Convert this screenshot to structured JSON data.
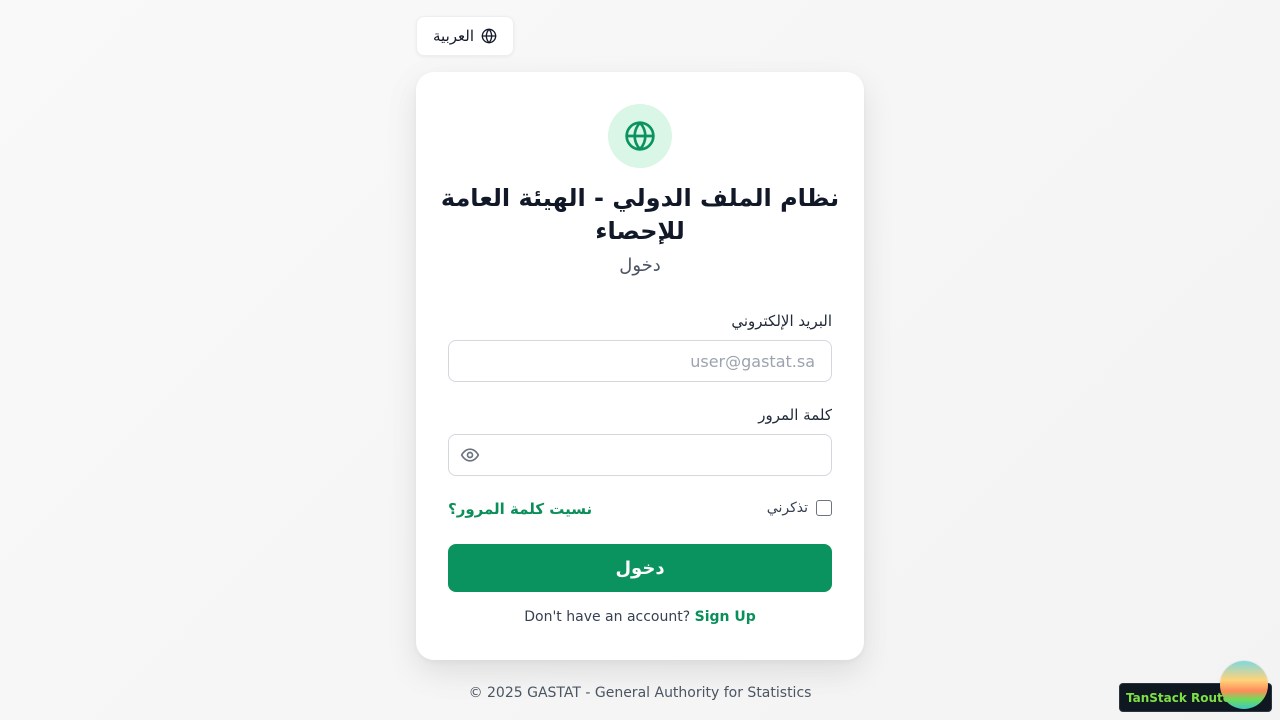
{
  "language_button": {
    "label": "العربية",
    "icon": "globe-icon"
  },
  "card": {
    "logo_icon": "globe-icon",
    "title": "نظام الملف الدولي - الهيئة العامة للإحصاء",
    "subtitle": "دخول",
    "email": {
      "label": "البريد الإلكتروني",
      "placeholder": "user@gastat.sa",
      "value": ""
    },
    "password": {
      "label": "كلمة المرور",
      "value": "",
      "toggle_icon": "eye-icon"
    },
    "remember_label": "تذكرني",
    "remember_checked": false,
    "forgot_label": "نسيت كلمة المرور؟",
    "submit_label": "دخول",
    "signup_prompt": "Don't have an account?",
    "signup_link": "Sign Up"
  },
  "footer": "© 2025 GASTAT - General Authority for Statistics",
  "devtools": {
    "label": "TanStack Router"
  },
  "colors": {
    "primary": "#0a935e",
    "link": "#0b8f5a",
    "logo_bg": "#d9f6e6",
    "background": "#f6f6f6"
  }
}
